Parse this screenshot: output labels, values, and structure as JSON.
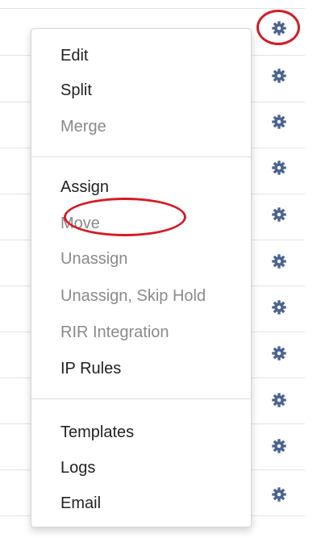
{
  "menu": {
    "groups": [
      [
        {
          "label": "Edit",
          "enabled": true
        },
        {
          "label": "Split",
          "enabled": true
        },
        {
          "label": "Merge",
          "enabled": false
        }
      ],
      [
        {
          "label": "Assign",
          "enabled": true,
          "highlighted": true
        },
        {
          "label": "Move",
          "enabled": false
        },
        {
          "label": "Unassign",
          "enabled": false
        },
        {
          "label": "Unassign, Skip Hold",
          "enabled": false
        },
        {
          "label": "RIR Integration",
          "enabled": false
        },
        {
          "label": "IP Rules",
          "enabled": true
        }
      ],
      [
        {
          "label": "Templates",
          "enabled": true
        },
        {
          "label": "Logs",
          "enabled": true
        },
        {
          "label": "Email",
          "enabled": true
        }
      ]
    ]
  },
  "gear_buttons": {
    "icon": "gear-icon",
    "count": 11,
    "highlighted_index": 0
  },
  "colors": {
    "gear": "#4a6491",
    "highlight": "#d31c28",
    "text_enabled": "#222222",
    "text_disabled": "#8a8a8a"
  }
}
